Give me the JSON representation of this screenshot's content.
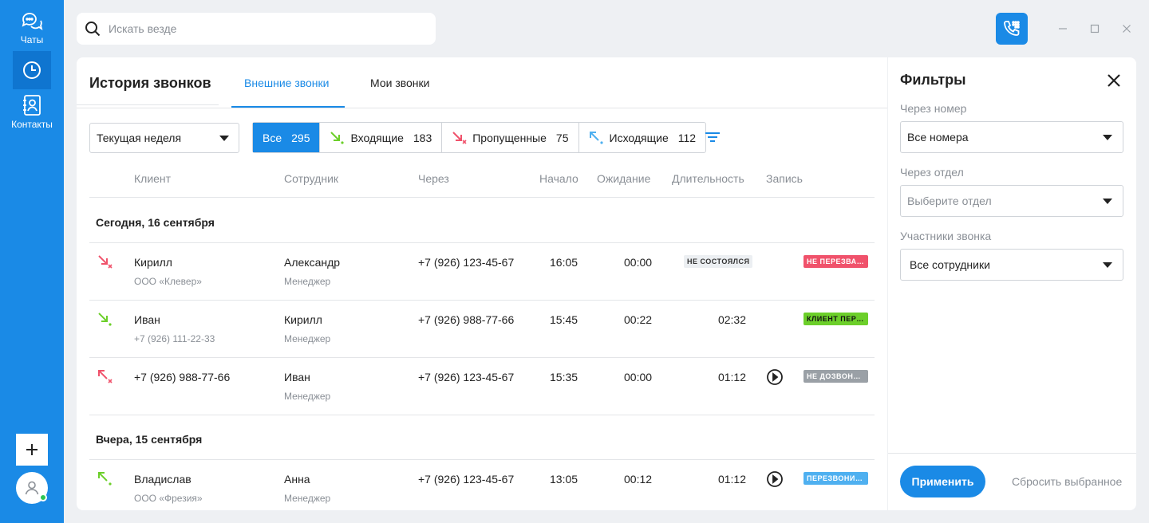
{
  "colors": {
    "accent": "#1a8ae6",
    "missed": "#f0526b",
    "callback": "#6ccf2a",
    "failed": "#9aa0a6",
    "called_back": "#4fb0f0"
  },
  "sidebar": {
    "items": [
      {
        "label": "Чаты",
        "icon": "chat-icon"
      },
      {
        "label": "",
        "icon": "clock-icon"
      },
      {
        "label": "Контакты",
        "icon": "contacts-icon"
      }
    ],
    "add_icon": "plus-icon",
    "avatar_icon": "user-icon"
  },
  "search": {
    "placeholder": "Искать везде"
  },
  "window": {
    "dialer_icon": "phone-dialpad-icon"
  },
  "main": {
    "title": "История звонков",
    "tabs": [
      {
        "label": "Внешние звонки",
        "active": true
      },
      {
        "label": "Мои звонки",
        "active": false
      }
    ],
    "period": "Текущая неделя",
    "segments": [
      {
        "label": "Все",
        "count": "295",
        "active": true
      },
      {
        "label": "Входящие",
        "count": "183",
        "icon": "incoming-icon"
      },
      {
        "label": "Пропущенные",
        "count": "75",
        "icon": "missed-icon"
      },
      {
        "label": "Исходящие",
        "count": "112",
        "icon": "outgoing-icon"
      }
    ],
    "columns": [
      "Клиент",
      "Сотрудник",
      "Через",
      "Начало",
      "Ожидание",
      "Длительность",
      "Запись"
    ],
    "groups": [
      {
        "title": "Сегодня, 16 сентября",
        "rows": [
          {
            "type": "missed",
            "client": "Кирилл",
            "client_sub": "ООО «Клевер»",
            "employee": "Александр",
            "employee_sub": "Менеджер",
            "via": "+7 (926) 123-45-67",
            "start": "16:05",
            "wait": "00:00",
            "duration": "",
            "not_happened": "НЕ СОСТОЯЛСЯ",
            "has_record": false,
            "status": "НЕ ПЕРЕЗВАНИВАЛИ",
            "status_color": "#f0526b"
          },
          {
            "type": "incoming",
            "client": "Иван",
            "client_sub": "+7 (926) 111-22-33",
            "employee": "Кирилл",
            "employee_sub": "Менеджер",
            "via": "+7 (926) 988-77-66",
            "start": "15:45",
            "wait": "00:22",
            "duration": "02:32",
            "not_happened": "",
            "has_record": false,
            "status": "КЛИЕНТ ПЕРЕЗВОНИЛ",
            "status_color": "#6ccf2a"
          },
          {
            "type": "outgoing-failed",
            "client": "+7 (926) 988-77-66",
            "client_sub": "",
            "employee": "Иван",
            "employee_sub": "Менеджер",
            "via": "+7 (926) 123-45-67",
            "start": "15:35",
            "wait": "00:00",
            "duration": "01:12",
            "not_happened": "",
            "has_record": true,
            "status": "НЕ ДОЗВОНИЛИСЬ",
            "status_color": "#9aa0a6"
          }
        ]
      },
      {
        "title": "Вчера, 15 сентября",
        "rows": [
          {
            "type": "outgoing",
            "client": "Владислав",
            "client_sub": "ООО «Фрезия»",
            "employee": "Анна",
            "employee_sub": "Менеджер",
            "via": "+7 (926) 123-45-67",
            "start": "13:05",
            "wait": "00:12",
            "duration": "01:12",
            "not_happened": "",
            "has_record": true,
            "status": "ПЕРЕЗВОНИЛИ",
            "status_color": "#4fb0f0"
          }
        ]
      }
    ]
  },
  "filters": {
    "title": "Фильтры",
    "fields": [
      {
        "label": "Через номер",
        "value": "Все номера",
        "placeholder": false
      },
      {
        "label": "Через отдел",
        "value": "Выберите отдел",
        "placeholder": true
      },
      {
        "label": "Участники звонка",
        "value": "Все сотрудники",
        "placeholder": false
      }
    ],
    "apply": "Применить",
    "reset": "Сбросить выбранное"
  }
}
